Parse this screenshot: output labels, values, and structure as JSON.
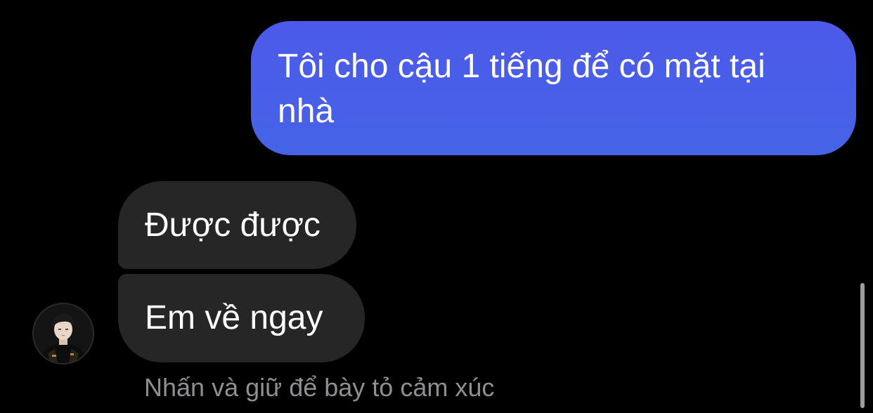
{
  "messages": {
    "outgoing": {
      "text": "Tôi cho cậu 1 tiếng để có mặt tại nhà",
      "bubble_color": "#4a5ee8"
    },
    "incoming": [
      {
        "text": "Được được"
      },
      {
        "text": "Em về ngay"
      }
    ],
    "incoming_bubble_color": "#262626"
  },
  "reaction_hint": "Nhấn và giữ để bày tỏ cảm xúc",
  "sender_avatar": {
    "icon": "user-avatar"
  },
  "colors": {
    "background": "#000000",
    "hint_text": "#8e8e93",
    "scrollbar": "#9c9c9c"
  }
}
